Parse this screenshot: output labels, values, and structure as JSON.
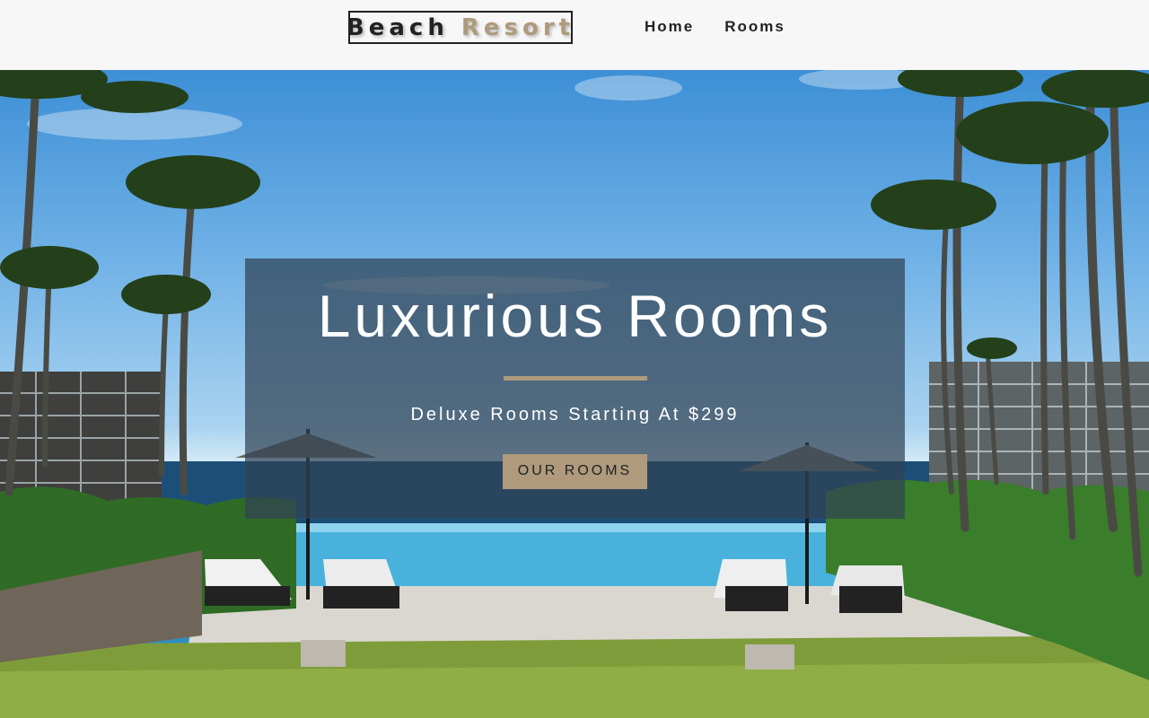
{
  "navbar": {
    "logo": {
      "word1": "Beach",
      "word2": "Resort"
    },
    "links": [
      {
        "label": "Home"
      },
      {
        "label": "Rooms"
      }
    ]
  },
  "hero": {
    "title": "Luxurious Rooms",
    "subtitle": "Deluxe Rooms Starting At $299",
    "button_label": "OUR ROOMS"
  },
  "colors": {
    "accent": "#af9a7d",
    "dark": "#222222",
    "navbar_bg": "#f7f7f7",
    "banner_bg": "rgba(48,66,84,0.72)"
  }
}
